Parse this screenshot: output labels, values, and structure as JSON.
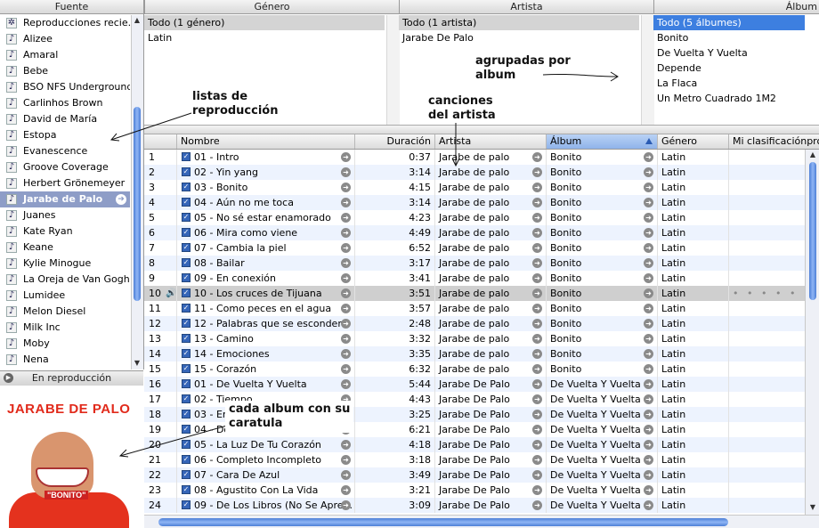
{
  "sidebar": {
    "header": "Fuente",
    "items": [
      {
        "label": "Reproducciones recie...",
        "icon": "gear-icon"
      },
      {
        "label": "Alizee",
        "icon": "music-note-icon"
      },
      {
        "label": "Amaral",
        "icon": "music-note-icon"
      },
      {
        "label": "Bebe",
        "icon": "music-note-icon"
      },
      {
        "label": "BSO NFS Underground",
        "icon": "music-note-icon"
      },
      {
        "label": "Carlinhos Brown",
        "icon": "music-note-icon"
      },
      {
        "label": "David de María",
        "icon": "music-note-icon"
      },
      {
        "label": "Estopa",
        "icon": "music-note-icon"
      },
      {
        "label": "Evanescence",
        "icon": "music-note-icon"
      },
      {
        "label": "Groove Coverage",
        "icon": "music-note-icon"
      },
      {
        "label": "Herbert Grönemeyer",
        "icon": "music-note-icon"
      },
      {
        "label": "Jarabe de Palo",
        "icon": "music-note-icon",
        "selected": true
      },
      {
        "label": "Juanes",
        "icon": "music-note-icon"
      },
      {
        "label": "Kate Ryan",
        "icon": "music-note-icon"
      },
      {
        "label": "Keane",
        "icon": "music-note-icon"
      },
      {
        "label": "Kylie Minogue",
        "icon": "music-note-icon"
      },
      {
        "label": "La Oreja de Van Gogh",
        "icon": "music-note-icon"
      },
      {
        "label": "Lumidee",
        "icon": "music-note-icon"
      },
      {
        "label": "Melon Diesel",
        "icon": "music-note-icon"
      },
      {
        "label": "Milk Inc",
        "icon": "music-note-icon"
      },
      {
        "label": "Moby",
        "icon": "music-note-icon"
      },
      {
        "label": "Nena",
        "icon": "music-note-icon"
      }
    ]
  },
  "now_playing": {
    "header": "En reproducción",
    "art_brand": "JARABE DE PALO",
    "art_label": "\"BONITO\""
  },
  "browser": {
    "genre": {
      "header": "Género",
      "items": [
        "Todo (1 género)",
        "Latin"
      ]
    },
    "artist": {
      "header": "Artista",
      "items": [
        "Todo (1 artista)",
        "Jarabe De Palo"
      ]
    },
    "album": {
      "header": "Álbum",
      "items": [
        "Todo (5 álbumes)",
        "Bonito",
        "De Vuelta Y Vuelta",
        "Depende",
        "La Flaca",
        "Un Metro Cuadrado 1M2"
      ]
    }
  },
  "table": {
    "columns": {
      "name": "Nombre",
      "duration": "Duración",
      "artist": "Artista",
      "album": "Álbum",
      "genre": "Género",
      "rating": "Mi clasificación",
      "plays": "proc"
    },
    "rows": [
      {
        "n": "1",
        "name": "01 - Intro",
        "dur": "0:37",
        "artist": "Jarabe de palo",
        "album": "Bonito",
        "genre": "Latin"
      },
      {
        "n": "2",
        "name": "02 - Yin yang",
        "dur": "3:14",
        "artist": "Jarabe de palo",
        "album": "Bonito",
        "genre": "Latin"
      },
      {
        "n": "3",
        "name": "03 - Bonito",
        "dur": "4:15",
        "artist": "Jarabe de palo",
        "album": "Bonito",
        "genre": "Latin"
      },
      {
        "n": "4",
        "name": "04 - Aún no me toca",
        "dur": "3:14",
        "artist": "Jarabe de palo",
        "album": "Bonito",
        "genre": "Latin"
      },
      {
        "n": "5",
        "name": "05 - No sé estar enamorado",
        "dur": "4:23",
        "artist": "Jarabe de palo",
        "album": "Bonito",
        "genre": "Latin"
      },
      {
        "n": "6",
        "name": "06 - Mira como viene",
        "dur": "4:49",
        "artist": "Jarabe de palo",
        "album": "Bonito",
        "genre": "Latin"
      },
      {
        "n": "7",
        "name": "07 - Cambia la piel",
        "dur": "6:52",
        "artist": "Jarabe de palo",
        "album": "Bonito",
        "genre": "Latin"
      },
      {
        "n": "8",
        "name": "08 - Bailar",
        "dur": "3:17",
        "artist": "Jarabe de palo",
        "album": "Bonito",
        "genre": "Latin"
      },
      {
        "n": "9",
        "name": "09 - En conexión",
        "dur": "3:41",
        "artist": "Jarabe de palo",
        "album": "Bonito",
        "genre": "Latin"
      },
      {
        "n": "10",
        "name": "10 - Los cruces de Tijuana",
        "dur": "3:51",
        "artist": "Jarabe de palo",
        "album": "Bonito",
        "genre": "Latin",
        "playing": true,
        "rating": "• • • • •"
      },
      {
        "n": "11",
        "name": "11 - Como peces en el agua",
        "dur": "3:57",
        "artist": "Jarabe de palo",
        "album": "Bonito",
        "genre": "Latin"
      },
      {
        "n": "12",
        "name": "12 - Palabras que se esconden",
        "dur": "2:48",
        "artist": "Jarabe de palo",
        "album": "Bonito",
        "genre": "Latin"
      },
      {
        "n": "13",
        "name": "13 - Camino",
        "dur": "3:32",
        "artist": "Jarabe de palo",
        "album": "Bonito",
        "genre": "Latin"
      },
      {
        "n": "14",
        "name": "14 - Emociones",
        "dur": "3:35",
        "artist": "Jarabe de palo",
        "album": "Bonito",
        "genre": "Latin"
      },
      {
        "n": "15",
        "name": "15 - Corazón",
        "dur": "6:32",
        "artist": "Jarabe de palo",
        "album": "Bonito",
        "genre": "Latin"
      },
      {
        "n": "16",
        "name": "01 - De Vuelta Y Vuelta",
        "dur": "5:44",
        "artist": "Jarabe De Palo",
        "album": "De Vuelta Y Vuelta",
        "genre": "Latin"
      },
      {
        "n": "17",
        "name": "02 - Tiempo",
        "dur": "4:43",
        "artist": "Jarabe De Palo",
        "album": "De Vuelta Y Vuelta",
        "genre": "Latin"
      },
      {
        "n": "18",
        "name": "03 - En L",
        "dur": "3:25",
        "artist": "Jarabe De Palo",
        "album": "De Vuelta Y Vuelta",
        "genre": "Latin"
      },
      {
        "n": "19",
        "name": "04 - Dos",
        "dur": "6:21",
        "artist": "Jarabe De Palo",
        "album": "De Vuelta Y Vuelta",
        "genre": "Latin"
      },
      {
        "n": "20",
        "name": "05 - La Luz De Tu Corazón",
        "dur": "4:18",
        "artist": "Jarabe De Palo",
        "album": "De Vuelta Y Vuelta",
        "genre": "Latin"
      },
      {
        "n": "21",
        "name": "06 - Completo Incompleto",
        "dur": "3:18",
        "artist": "Jarabe De Palo",
        "album": "De Vuelta Y Vuelta",
        "genre": "Latin"
      },
      {
        "n": "22",
        "name": "07 - Cara De Azul",
        "dur": "3:49",
        "artist": "Jarabe De Palo",
        "album": "De Vuelta Y Vuelta",
        "genre": "Latin"
      },
      {
        "n": "23",
        "name": "08 - Agustito Con La Vida",
        "dur": "3:21",
        "artist": "Jarabe De Palo",
        "album": "De Vuelta Y Vuelta",
        "genre": "Latin"
      },
      {
        "n": "24",
        "name": "09 - De Los Libros (No Se Apre...",
        "dur": "3:09",
        "artist": "Jarabe De Palo",
        "album": "De Vuelta Y Vuelta",
        "genre": "Latin"
      }
    ]
  },
  "annotations": {
    "playlists": "listas de\nreproducción",
    "songs": "canciones\ndel artista",
    "grouped": "agrupadas por\nalbum",
    "cover": "cada album con su\ncaratula"
  },
  "colors": {
    "selection": "#8e9dc7",
    "accent": "#3d7fe0",
    "alt_row": "#edf3fe"
  }
}
